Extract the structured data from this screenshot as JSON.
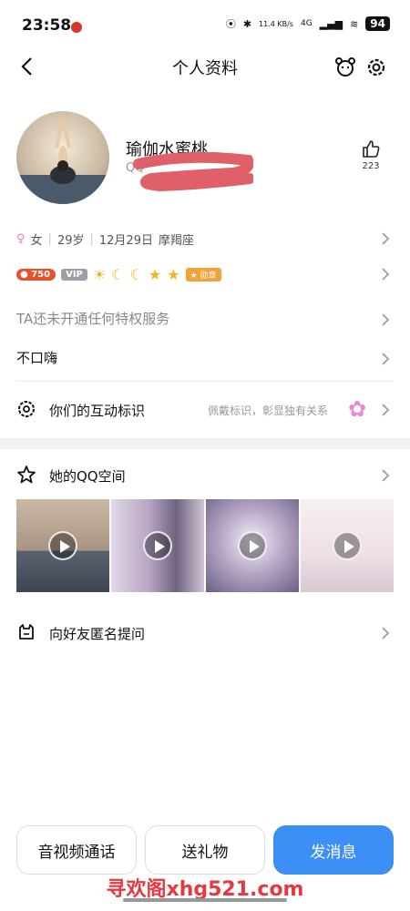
{
  "status_bar": {
    "time": "23:58",
    "network_speed": "11.4 KB/s",
    "network_type": "4G",
    "battery": "94"
  },
  "header": {
    "title": "个人资料"
  },
  "profile": {
    "nickname": "瑜伽水蜜桃",
    "qq_prefix": "QQ",
    "likes": "223"
  },
  "info": {
    "gender": "女",
    "age": "29岁",
    "birthday": "12月29日",
    "zodiac": "摩羯座"
  },
  "badges": {
    "level_points": "750",
    "vip_label": "VIP",
    "medal_label": "勋章"
  },
  "rows": {
    "privilege": "TA还未开通任何特权服务",
    "signature": "不口嗨",
    "interaction_title": "你们的互动标识",
    "interaction_hint": "佩戴标识，彰显独有关系",
    "qzone_title": "她的QQ空间",
    "anonymous_question": "向好友匿名提问"
  },
  "actions": {
    "call": "音视频通话",
    "gift": "送礼物",
    "message": "发消息"
  },
  "watermark": "寻欢阁xhg521.com",
  "colors": {
    "accent": "#3b8ff5",
    "level_badge": "#e8522b",
    "watermark": "#e6393f"
  }
}
